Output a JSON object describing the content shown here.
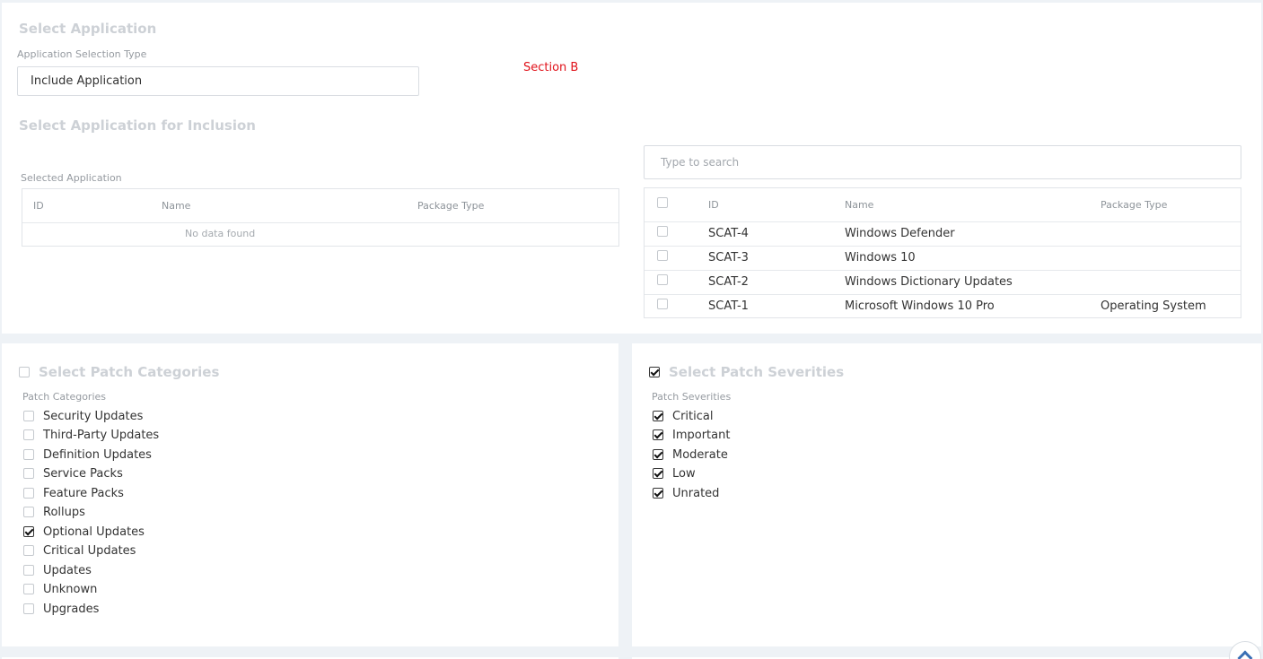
{
  "app_section": {
    "title": "Select Application",
    "selection_type_label": "Application Selection Type",
    "selection_type_value": "Include Application",
    "annotation": "Section B",
    "inclusion_title": "Select Application for Inclusion",
    "selected_label": "Selected Application",
    "selected_table": {
      "columns": [
        "ID",
        "Name",
        "Package Type"
      ],
      "empty_text": "No data found"
    },
    "search": {
      "placeholder": "Type to search"
    },
    "available_table": {
      "columns": [
        "ID",
        "Name",
        "Package Type"
      ],
      "rows": [
        {
          "id": "SCAT-4",
          "name": "Windows Defender",
          "package_type": ""
        },
        {
          "id": "SCAT-3",
          "name": "Windows 10",
          "package_type": ""
        },
        {
          "id": "SCAT-2",
          "name": "Windows Dictionary Updates",
          "package_type": ""
        },
        {
          "id": "SCAT-1",
          "name": "Microsoft Windows 10 Pro",
          "package_type": "Operating System"
        }
      ]
    }
  },
  "categories": {
    "title": "Select Patch Categories",
    "header_checked": false,
    "label": "Patch Categories",
    "items": [
      {
        "label": "Security Updates",
        "checked": false
      },
      {
        "label": "Third-Party Updates",
        "checked": false
      },
      {
        "label": "Definition Updates",
        "checked": false
      },
      {
        "label": "Service Packs",
        "checked": false
      },
      {
        "label": "Feature Packs",
        "checked": false
      },
      {
        "label": "Rollups",
        "checked": false
      },
      {
        "label": "Optional Updates",
        "checked": true
      },
      {
        "label": "Critical Updates",
        "checked": false
      },
      {
        "label": "Updates",
        "checked": false
      },
      {
        "label": "Unknown",
        "checked": false
      },
      {
        "label": "Upgrades",
        "checked": false
      }
    ]
  },
  "severities": {
    "title": "Select Patch Severities",
    "header_checked": true,
    "label": "Patch Severities",
    "items": [
      {
        "label": "Critical",
        "checked": true
      },
      {
        "label": "Important",
        "checked": true
      },
      {
        "label": "Moderate",
        "checked": true
      },
      {
        "label": "Low",
        "checked": true
      },
      {
        "label": "Unrated",
        "checked": true
      }
    ]
  },
  "colors": {
    "accent": "#3a6fb5",
    "annotation": "#e0121a",
    "title": "#cdd1d6"
  },
  "icons": {
    "scroll_top": "chevron-up-icon"
  }
}
